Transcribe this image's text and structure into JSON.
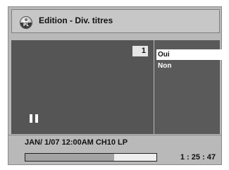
{
  "header": {
    "icon": "pl-disc-icon",
    "icon_label": "PL",
    "title": "Edition - Div. titres"
  },
  "preview": {
    "title_number": "1",
    "playback_state_icon": "pause-icon"
  },
  "menu": {
    "options": [
      {
        "label": "Oui",
        "selected": true
      },
      {
        "label": "Non",
        "selected": false
      }
    ]
  },
  "info": {
    "recording": "JAN/ 1/07 12:00AM CH10   LP"
  },
  "playback": {
    "progress": 0.68,
    "time": "1 : 25 : 47"
  },
  "colors": {
    "frame": "#b9b9b9",
    "video": "#555555",
    "options_bg": "#5a5a5a",
    "selection": "#ffffff",
    "progress_fill": "#a3a3a3"
  }
}
